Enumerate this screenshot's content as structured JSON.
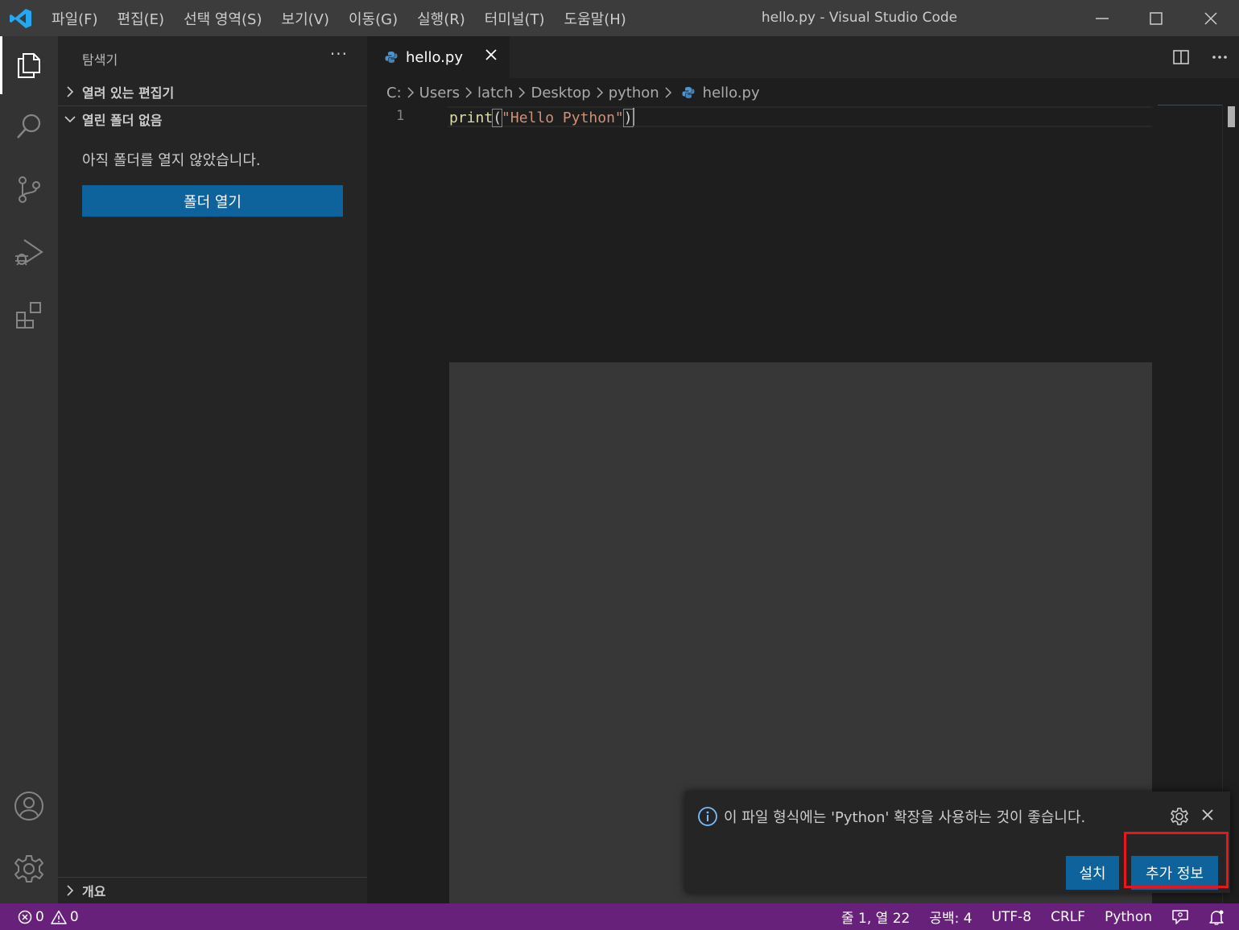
{
  "titlebar": {
    "menu": [
      "파일(F)",
      "편집(E)",
      "선택 영역(S)",
      "보기(V)",
      "이동(G)",
      "실행(R)",
      "터미널(T)",
      "도움말(H)"
    ],
    "title": "hello.py - Visual Studio Code"
  },
  "sidebar": {
    "title": "탐색기",
    "more": "···",
    "open_editors": "열려 있는 편집기",
    "no_folder": "열린 폴더 없음",
    "empty_message": "아직 폴더를 열지 않았습니다.",
    "open_folder_button": "폴더 열기",
    "outline": "개요"
  },
  "editor": {
    "tab_label": "hello.py",
    "breadcrumb": [
      "C:",
      "Users",
      "latch",
      "Desktop",
      "python",
      "hello.py"
    ],
    "line_number": "1",
    "code": {
      "fn": "print",
      "open": "(",
      "str": "\"Hello Python\"",
      "close": ")"
    }
  },
  "notification": {
    "message": "이 파일 형식에는 'Python' 확장을 사용하는 것이 좋습니다.",
    "install_button": "설치",
    "more_info_button": "추가 정보"
  },
  "statusbar": {
    "errors": "0",
    "warnings": "0",
    "position": "줄 1, 열 22",
    "spaces": "공백: 4",
    "encoding": "UTF-8",
    "eol": "CRLF",
    "language": "Python"
  },
  "colors": {
    "accent": "#0e639c",
    "statusbar": "#68217a",
    "highlight_box": "#e8161c"
  }
}
